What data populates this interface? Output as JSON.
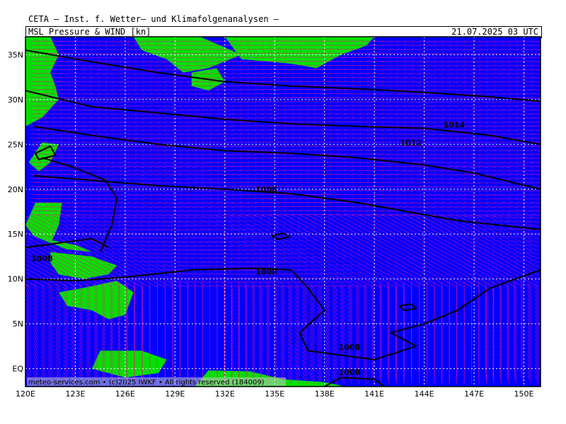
{
  "header": {
    "org": "CETA – Inst. f. Wetter– und Klimafolgenanalysen –",
    "field": "MSL_Pressure_&_WIND [kn]",
    "datetime": "21.07.2025 03 UTC"
  },
  "credit": "meteo-services.com • (c)2025 IWKF • All rights reserved (184009)",
  "map": {
    "lon_range": [
      120,
      151
    ],
    "lat_range": [
      -2,
      37
    ],
    "lon_ticks": [
      "120E",
      "123E",
      "126E",
      "129E",
      "132E",
      "135E",
      "138E",
      "141E",
      "144E",
      "147E",
      "150E"
    ],
    "lat_ticks": [
      "35N",
      "30N",
      "25N",
      "20N",
      "15N",
      "10N",
      "5N",
      "EQ"
    ],
    "colors": {
      "ocean": "#0000ff",
      "land": "#00e000",
      "wind": "#ff1493",
      "isobar": "#000000",
      "grid": "#ffffff"
    },
    "isobar_labels": [
      {
        "text": "1014",
        "lon": 145.8,
        "lat": 27.2
      },
      {
        "text": "1012",
        "lon": 143.2,
        "lat": 25.2
      },
      {
        "text": "1008",
        "lon": 134.5,
        "lat": 20.0
      },
      {
        "text": "1008",
        "lon": 134.5,
        "lat": 10.8
      },
      {
        "text": "1008",
        "lon": 121.0,
        "lat": 12.3
      },
      {
        "text": "1008",
        "lon": 139.5,
        "lat": 2.4
      },
      {
        "text": "1008",
        "lon": 139.5,
        "lat": -0.4
      }
    ]
  }
}
